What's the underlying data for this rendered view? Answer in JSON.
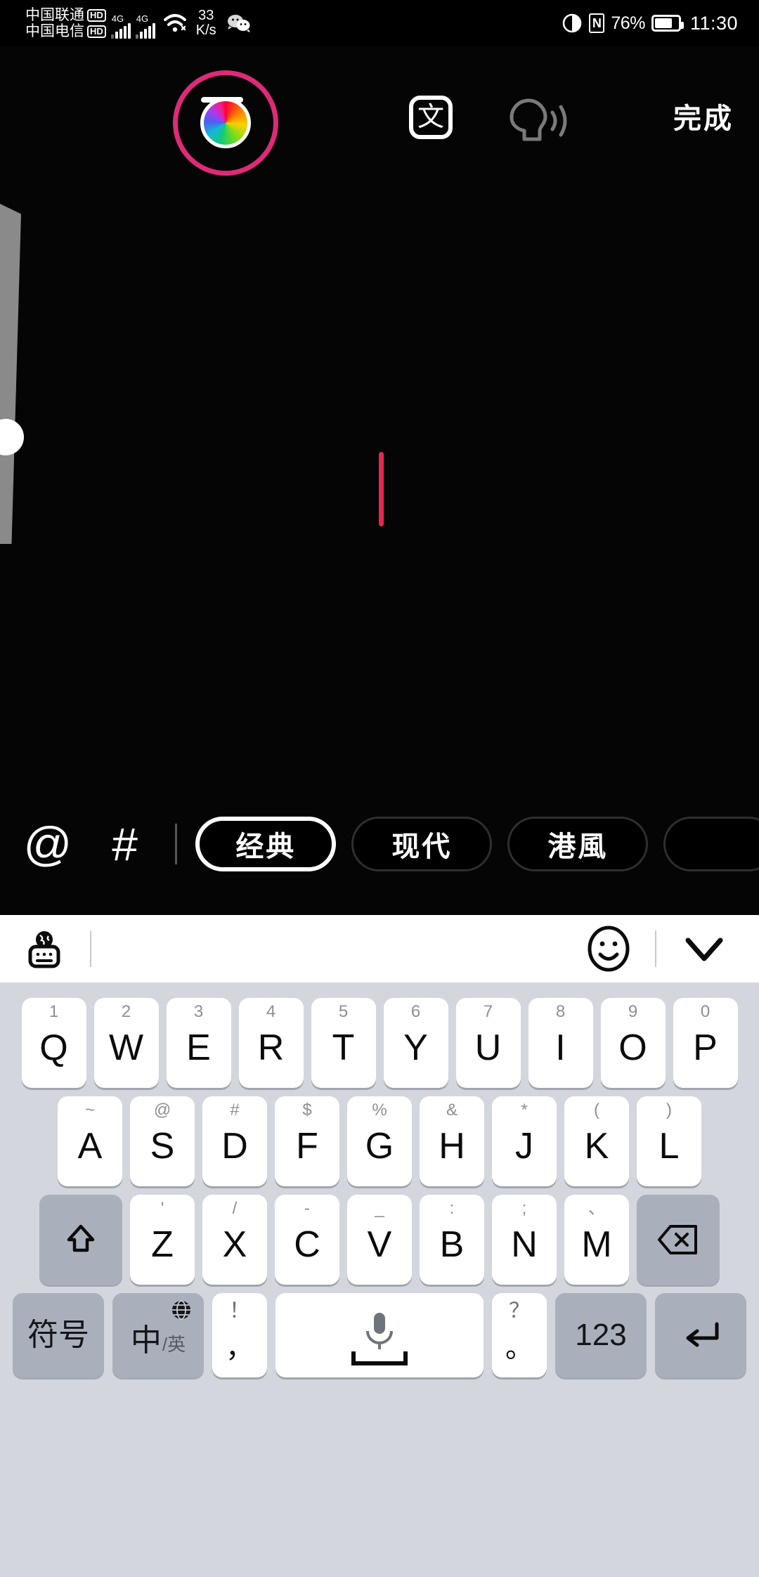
{
  "status_bar": {
    "carrier1": "中国联通",
    "carrier1_badge": "HD",
    "carrier2": "中国电信",
    "carrier2_badge": "HD",
    "network1": "4G",
    "network2": "4G",
    "net_speed_value": "33",
    "net_speed_unit": "K/s",
    "wechat_icon": "wechat-icon",
    "eye_icon": "eye-protection-icon",
    "nfc_icon": "nfc-icon",
    "nfc_label": "N",
    "battery_percent": "76%",
    "clock": "11:30"
  },
  "editor": {
    "toolbar": {
      "align_icon": "text-align-icon",
      "color_icon": "color-wheel-icon",
      "color_ring_hex": "#DE2A78",
      "language_label": "文",
      "tts_icon": "text-to-speech-icon",
      "tts_disabled_hex": "#7a7a7a",
      "done_label": "完成"
    },
    "size_slider": {
      "name": "font-size-slider",
      "track_hex": "#8a8a8a",
      "thumb_hex": "#ffffff"
    },
    "caret_hex": "#E8274E",
    "canvas_hex": "#050505",
    "bottom_bar": {
      "mention_icon": "@",
      "hashtag_icon": "#",
      "styles": [
        {
          "label": "经典",
          "selected": true
        },
        {
          "label": "现代",
          "selected": false
        },
        {
          "label": "港風",
          "selected": false
        },
        {
          "label": "",
          "selected": false
        }
      ]
    }
  },
  "keyboard_toolbar": {
    "ime_switch_icon": "globe-keyboard-icon",
    "emoji_icon": "emoji-smiley-icon",
    "collapse_icon": "chevron-down-icon"
  },
  "keyboard": {
    "background_hex": "#d3d6dc",
    "key_hex": "#ffffff",
    "fn_key_hex": "#aab0bb",
    "row1": [
      {
        "main": "Q",
        "hint": "1"
      },
      {
        "main": "W",
        "hint": "2"
      },
      {
        "main": "E",
        "hint": "3"
      },
      {
        "main": "R",
        "hint": "4"
      },
      {
        "main": "T",
        "hint": "5"
      },
      {
        "main": "Y",
        "hint": "6"
      },
      {
        "main": "U",
        "hint": "7"
      },
      {
        "main": "I",
        "hint": "8"
      },
      {
        "main": "O",
        "hint": "9"
      },
      {
        "main": "P",
        "hint": "0"
      }
    ],
    "row2": [
      {
        "main": "A",
        "hint": "~"
      },
      {
        "main": "S",
        "hint": "@"
      },
      {
        "main": "D",
        "hint": "#"
      },
      {
        "main": "F",
        "hint": "$"
      },
      {
        "main": "G",
        "hint": "%"
      },
      {
        "main": "H",
        "hint": "&"
      },
      {
        "main": "J",
        "hint": "*"
      },
      {
        "main": "K",
        "hint": "("
      },
      {
        "main": "L",
        "hint": ")"
      }
    ],
    "row3": {
      "shift_icon": "shift-icon",
      "letters": [
        {
          "main": "Z",
          "hint": "'"
        },
        {
          "main": "X",
          "hint": "/"
        },
        {
          "main": "C",
          "hint": "-"
        },
        {
          "main": "V",
          "hint": "_"
        },
        {
          "main": "B",
          "hint": ":"
        },
        {
          "main": "N",
          "hint": ";"
        },
        {
          "main": "M",
          "hint": "、"
        }
      ],
      "backspace_icon": "backspace-icon"
    },
    "row4": {
      "symbols_label": "符号",
      "lang_zh": "中",
      "lang_slash": "/",
      "lang_en": "英",
      "lang_globe_icon": "globe-icon",
      "comma_hint": "！",
      "comma_main": "，",
      "space_icon": "microphone-icon",
      "period_hint": "？",
      "period_main": "。",
      "numbers_label": "123",
      "enter_icon": "enter-icon"
    }
  }
}
